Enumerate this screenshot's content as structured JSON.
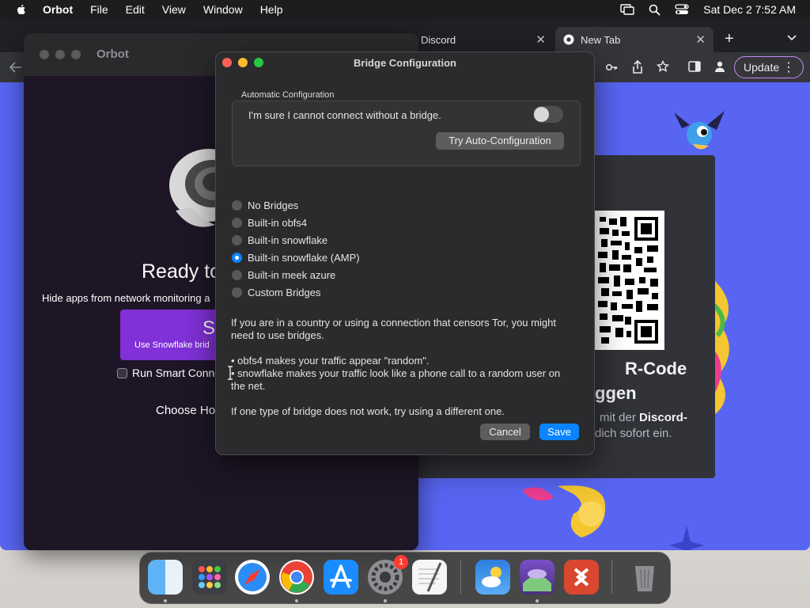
{
  "menubar": {
    "app": "Orbot",
    "items": [
      "File",
      "Edit",
      "View",
      "Window",
      "Help"
    ],
    "clock": "Sat Dec 2  7:52 AM"
  },
  "chrome": {
    "tabs": [
      {
        "label": "Discord"
      },
      {
        "label": "New Tab"
      }
    ],
    "new_tab": "+",
    "update_label": "Update",
    "discord": {
      "title_line1": "R-Code",
      "title_line2": "ggen",
      "text_prefix": "mit der ",
      "text_bold": "Discord-",
      "text_line2": "dich sofort ein."
    }
  },
  "orbot": {
    "window_title": "Orbot",
    "ready": "Ready to",
    "hide_apps": "Hide apps from network monitoring a",
    "start_letter": "S",
    "start_sub": "Use Snowflake brid",
    "run_smart": "Run Smart Conne",
    "choose": "Choose Ho"
  },
  "dialog": {
    "title": "Bridge Configuration",
    "group_label": "Automatic Configuration",
    "sure_label": "I'm sure I cannot connect without a bridge.",
    "toggle_on": false,
    "auto_button": "Try Auto-Configuration",
    "options": [
      {
        "label": "No Bridges",
        "selected": false
      },
      {
        "label": "Built-in obfs4",
        "selected": false
      },
      {
        "label": "Built-in snowflake",
        "selected": false
      },
      {
        "label": "Built-in snowflake (AMP)",
        "selected": true
      },
      {
        "label": "Built-in meek azure",
        "selected": false
      },
      {
        "label": "Custom Bridges",
        "selected": false
      }
    ],
    "info1_line1": "If you are in a country or using a connection that censors Tor, you might",
    "info1_line2": "need to use bridges.",
    "bullet1": "• obfs4 makes your traffic appear \"random\".",
    "bullet2_line1": "• snowflake makes your traffic look like a phone call to a random user on",
    "bullet2_line2": "the net.",
    "info3": "If one type of bridge does not work, try using a different one.",
    "cancel": "Cancel",
    "save": "Save"
  },
  "dock": {
    "apps": [
      "finder-icon",
      "launchpad-icon",
      "safari-icon",
      "chrome-icon",
      "app-store-icon",
      "system-settings-icon",
      "textedit-icon",
      "weather-icon",
      "orbot-icon",
      "remote-desktop-icon",
      "trash-icon"
    ],
    "settings_badge": "1"
  },
  "colors": {
    "discord_blurple": "#5865f2",
    "accent": "#0a84ff",
    "orbot_purple": "#8131d8"
  }
}
